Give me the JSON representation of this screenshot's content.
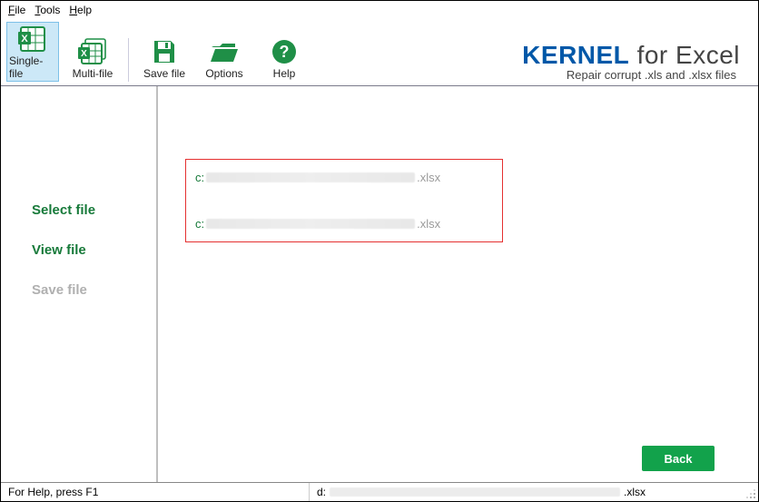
{
  "menu": {
    "file": "File",
    "tools": "Tools",
    "help": "Help"
  },
  "tools": {
    "single_file": "Single-file",
    "multi_file": "Multi-file",
    "save_file": "Save file",
    "options": "Options",
    "help": "Help"
  },
  "brand": {
    "strong": "KERNEL",
    "rest": " for Excel",
    "tagline": "Repair corrupt .xls and .xlsx files"
  },
  "sidebar": {
    "select": "Select file",
    "view": "View file",
    "save": "Save file"
  },
  "paths": [
    {
      "drive": "c:",
      "ext": ".xlsx"
    },
    {
      "drive": "c:",
      "ext": ".xlsx"
    }
  ],
  "buttons": {
    "back": "Back"
  },
  "status": {
    "help": "For Help, press F1",
    "drive": "d:",
    "ext": ".xlsx"
  }
}
